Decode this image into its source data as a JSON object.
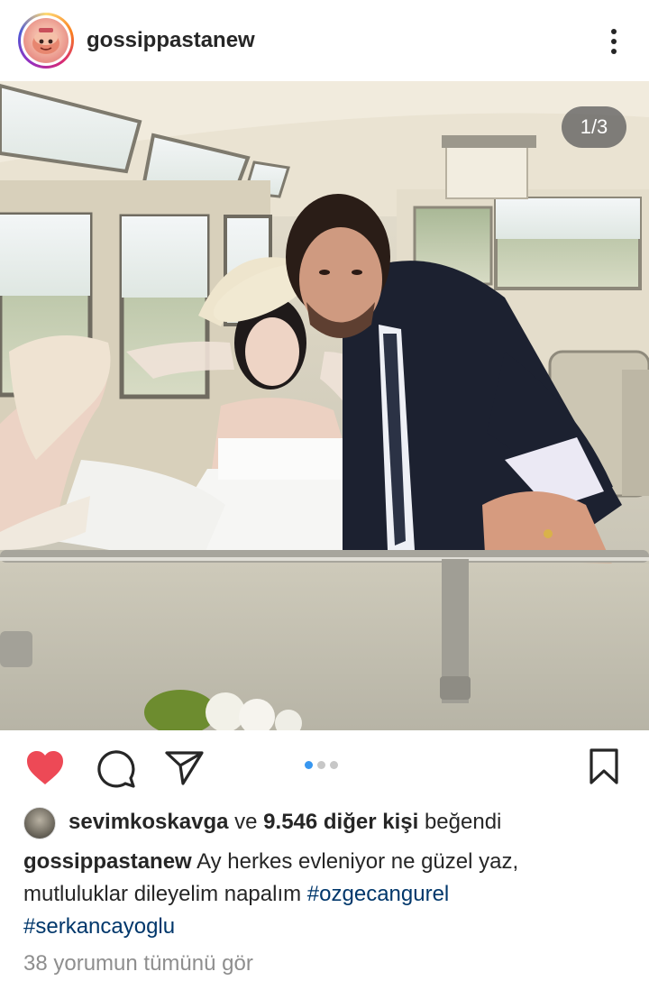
{
  "post": {
    "username": "gossippastanew",
    "counter": "1/3",
    "likes": {
      "first_liker": "sevimkoskavga",
      "connector": "ve",
      "others": "9.546 diğer kişi",
      "suffix": "beğendi"
    },
    "caption": {
      "user": "gossippastanew",
      "text": "Ay herkes evleniyor ne güzel yaz, mutluluklar dileyelim napalım",
      "hashtags": [
        "#ozgecangurel",
        "#serkancayoglu"
      ]
    },
    "comments_link": "38 yorumun tümünü gör",
    "carousel": {
      "count": 3,
      "active_index": 0
    },
    "liked": true
  },
  "colors": {
    "like_red": "#ed4956",
    "hashtag_blue": "#00376b",
    "dot_active": "#3897f0",
    "muted": "#8e8e8e"
  },
  "icons": {
    "header_more": "more-vertical-icon",
    "like": "heart-filled-icon",
    "comment": "comment-bubble-icon",
    "share": "paper-plane-icon",
    "save": "bookmark-icon"
  }
}
